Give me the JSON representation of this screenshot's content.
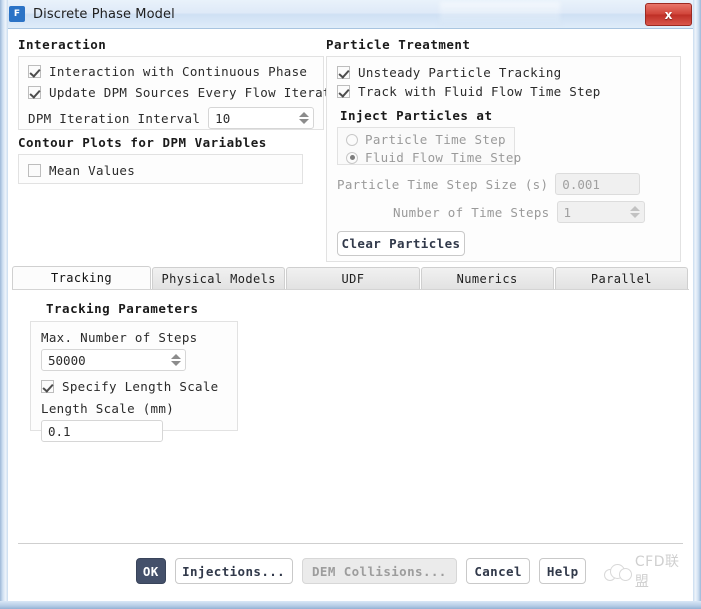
{
  "window": {
    "title": "Discrete Phase Model",
    "app_icon": "fluent-icon",
    "close_label": "✕",
    "close_glyph": "x"
  },
  "interaction": {
    "title": "Interaction",
    "checkbox_continuous": {
      "label": "Interaction with Continuous Phase",
      "checked": true
    },
    "checkbox_update_sources": {
      "label": "Update DPM Sources Every Flow Iteration",
      "checked": true
    },
    "iteration_interval": {
      "label": "DPM Iteration Interval",
      "value": "10"
    }
  },
  "contour_plots": {
    "title": "Contour Plots for DPM Variables",
    "checkbox_mean_values": {
      "label": "Mean Values",
      "checked": false
    }
  },
  "particle_treatment": {
    "title": "Particle Treatment",
    "checkbox_unsteady": {
      "label": "Unsteady Particle Tracking",
      "checked": true
    },
    "checkbox_track_fluid": {
      "label": "Track with Fluid Flow Time Step",
      "checked": true
    },
    "inject_title": "Inject Particles at",
    "radio_particle_time_step": {
      "label": "Particle Time Step",
      "selected": false
    },
    "radio_fluid_flow_time_step": {
      "label": "Fluid Flow Time Step",
      "selected": true
    },
    "particle_time_step_size": {
      "label": "Particle Time Step Size (s)",
      "value": "0.001"
    },
    "number_of_time_steps": {
      "label": "Number of Time Steps",
      "value": "1"
    },
    "clear_particles_label": "Clear Particles"
  },
  "tabs": [
    {
      "label": "Tracking",
      "active": true
    },
    {
      "label": "Physical Models",
      "active": false
    },
    {
      "label": "UDF",
      "active": false
    },
    {
      "label": "Numerics",
      "active": false
    },
    {
      "label": "Parallel",
      "active": false
    }
  ],
  "tracking": {
    "title": "Tracking Parameters",
    "max_steps": {
      "label": "Max. Number of Steps",
      "value": "50000"
    },
    "checkbox_specify_length_scale": {
      "label": "Specify Length Scale",
      "checked": true
    },
    "length_scale": {
      "label": "Length Scale (mm)",
      "value": "0.1"
    }
  },
  "footer": {
    "ok": "OK",
    "injections": "Injections...",
    "dem_collisions": "DEM Collisions...",
    "cancel": "Cancel",
    "help": "Help",
    "watermark": "CFD联盟"
  },
  "colors": {
    "primary_button": "#44506a",
    "close_button": "#c9382d",
    "titlebar": "#dfeaf8",
    "frame": "#9db8d8"
  }
}
